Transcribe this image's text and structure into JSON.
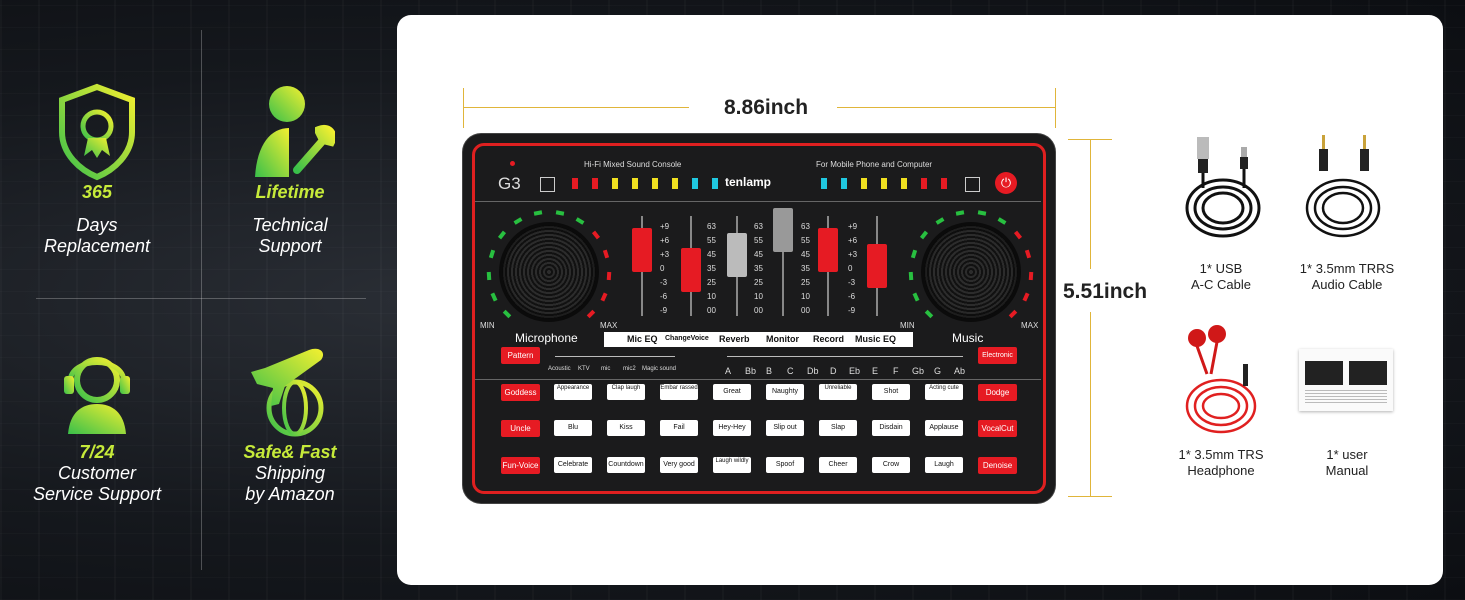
{
  "features": [
    {
      "highlight": "365",
      "lines": [
        "Days",
        "Replacement"
      ],
      "icon": "shield-ribbon-icon"
    },
    {
      "highlight": "Lifetime",
      "lines": [
        "Technical",
        "Support"
      ],
      "icon": "support-wrench-icon"
    },
    {
      "highlight": "7/24",
      "lines": [
        "Customer",
        "Service Support"
      ],
      "icon": "headset-agent-icon"
    },
    {
      "highlight": "Safe& Fast",
      "lines": [
        "Shipping",
        "by Amazon"
      ],
      "icon": "airplane-globe-icon"
    }
  ],
  "dimensions": {
    "width": "8.86inch",
    "height": "5.51inch"
  },
  "device": {
    "model": "G3",
    "brand": "tenlamp",
    "top_left_caption": "Hi-Fi   Mixed   Sound   Console",
    "top_right_caption": "For Mobile Phone and Computer",
    "mic_label": "Microphone",
    "music_label": "Music",
    "min_label": "MIN",
    "max_label": "MAX",
    "eq_labels": [
      "Mic EQ",
      "ChangeVoice",
      "Reverb",
      "Monitor",
      "Record",
      "Music EQ"
    ],
    "db_scale": [
      "+9",
      "+6",
      "+3",
      "0",
      "-3",
      "-6",
      "-9"
    ],
    "level_scale": [
      "63",
      "55",
      "45",
      "35",
      "25",
      "10",
      "00"
    ],
    "pattern_button": "Pattern",
    "electronic_button": "Electronic",
    "pattern_modes": [
      "Acoustic",
      "KTV",
      "mic",
      "mic2",
      "Magic sound"
    ],
    "keys": [
      "A",
      "Bb",
      "B",
      "C",
      "Db",
      "D",
      "Eb",
      "E",
      "F",
      "Gb",
      "G",
      "Ab"
    ],
    "rows": [
      {
        "left": "Goddess",
        "right": "Dodge",
        "pads": [
          "Appearance",
          "Clap laugh",
          "Embar rassed",
          "Great",
          "Naughty",
          "Unreliable",
          "Shot",
          "Acting cute"
        ]
      },
      {
        "left": "Uncle",
        "right": "VocalCut",
        "pads": [
          "Blu",
          "Kiss",
          "Fail",
          "Hey-Hey",
          "Slip out",
          "Slap",
          "Disdain",
          "Applause"
        ]
      },
      {
        "left": "Fun-Voice",
        "right": "Denoise",
        "pads": [
          "Celebrate",
          "Countdown",
          "Very good",
          "Laugh wildly",
          "Spoof",
          "Cheer",
          "Crow",
          "Laugh"
        ]
      }
    ]
  },
  "accessories": [
    {
      "label": [
        "1* USB",
        "A-C Cable"
      ],
      "icon": "usb-cable-icon"
    },
    {
      "label": [
        "1* 3.5mm TRRS",
        "Audio Cable"
      ],
      "icon": "audio-cable-icon"
    },
    {
      "label": [
        "1* 3.5mm TRS",
        "Headphone"
      ],
      "icon": "earphones-icon"
    },
    {
      "label": [
        "1* user",
        "Manual"
      ],
      "icon": "manual-icon"
    }
  ],
  "colors": {
    "accent_green": "#c6ea3a",
    "device_red": "#e61b23",
    "dim_line": "#e0b53a"
  }
}
